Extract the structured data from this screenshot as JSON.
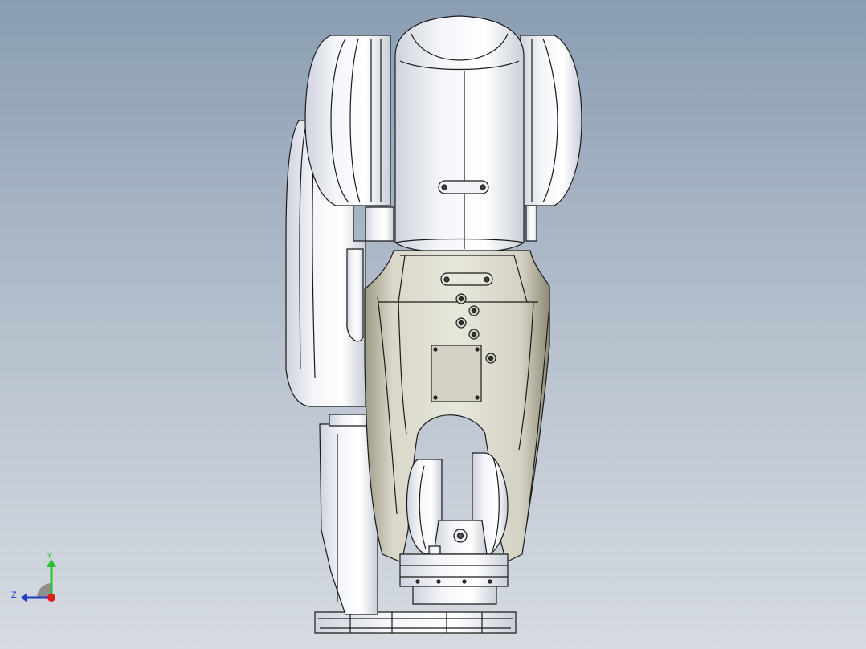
{
  "viewport": {
    "background_top": "#8a9db3",
    "background_bottom": "#d6dbe1"
  },
  "model": {
    "icon": "robot-arm-model",
    "primary_color": "#e9ecf3",
    "accent_color": "#b4b19f",
    "edge_color": "#1a1a1a"
  },
  "triad": {
    "y_label": "Y",
    "z_label": "Z",
    "y_color": "#2fbf2f",
    "z_color": "#1f3ec8",
    "x_color": "#e01b1b"
  }
}
